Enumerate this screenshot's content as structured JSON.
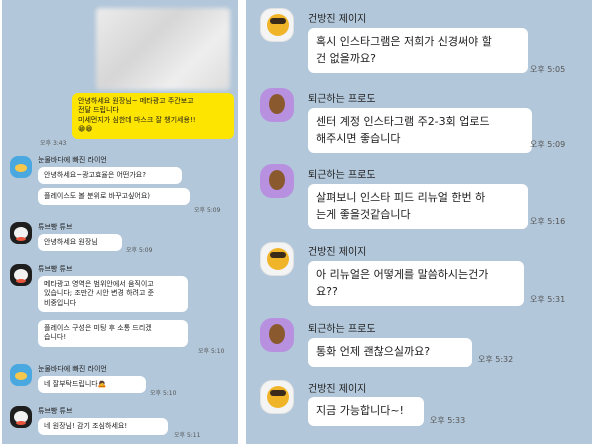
{
  "left": {
    "mine": {
      "text": "안녕하세요 원장님~ 메타광고 주간보고\n전달 드립니다\n미세먼지가 심한데 마스크 잘 챙기세용!!\n😁😁",
      "time": "오후 3:43"
    },
    "ryan1": {
      "name": "눈물바다에 빠진 라이언",
      "msg1": "안녕하세요~광고효율은 어떤가요?",
      "msg2": "플레이스도 볼 분위로 바꾸고싶어요)",
      "time": "오후 5:09"
    },
    "tube1": {
      "name": "튜브빵 튜브",
      "msg": "안녕하세요 원장님",
      "time": "오후 5:09"
    },
    "tube2": {
      "name": "튜브빵 튜브",
      "msg1": "메타광고 영역은 범위안에서 움직이고\n있습니다; 조만간 시안 변경 하려고 준\n비중입니다",
      "msg2": "플레이스 구성은 미팅 후 소통 드리겠\n습니다!",
      "time": "오후 5:10"
    },
    "ryan2": {
      "name": "눈물바다에 빠진 라이언",
      "msg": "네 잘부탁드립니다🙇",
      "time": "오후 5:10"
    },
    "tube3": {
      "name": "튜브빵 튜브",
      "msg": "네 원장님! 감기 조심하세요!",
      "time": "오후 5:11"
    }
  },
  "right": {
    "m1": {
      "name": "건방진 제이지",
      "msg": "혹시 인스타그램은 저희가 신경써야 할\n건 없을까요?",
      "time": "오후 5:05"
    },
    "m2": {
      "name": "퇴근하는 프로도",
      "msg": "센터 계정 인스타그램 주2-3회 업로드\n해주시면 좋습니다",
      "time": "오후 5:09"
    },
    "m3": {
      "name": "퇴근하는 프로도",
      "msg": "살펴보니 인스타 피드 리뉴얼 한번 하\n는게 좋을것같습니다",
      "time": "오후 5:16"
    },
    "m4": {
      "name": "건방진 제이지",
      "msg": "아 리뉴얼은 어떻게를 말씀하시는건가\n요??",
      "time": "오후 5:31"
    },
    "m5": {
      "name": "퇴근하는 프로도",
      "msg": "통화 언제 괜찮으실까요?",
      "time": "오후 5:32"
    },
    "m6": {
      "name": "건방진 제이지",
      "msg": "지금 가능합니다~!",
      "time": "오후 5:33"
    }
  },
  "icons": {
    "ryan": "ryan-avatar-icon",
    "tube": "tube-avatar-icon",
    "jay": "jay-g-avatar-icon",
    "frodo": "frodo-avatar-icon"
  },
  "colors": {
    "chat_background": "#b2c7da",
    "my_bubble": "#fee500",
    "other_bubble": "#ffffff"
  }
}
